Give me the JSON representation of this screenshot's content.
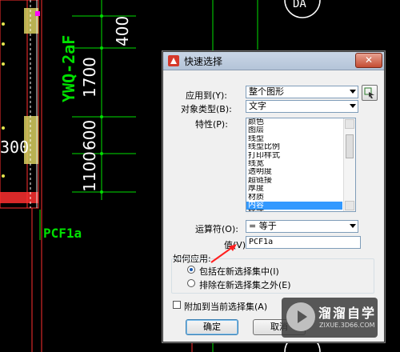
{
  "drawing": {
    "dim_400": "400",
    "dim_1700": "1700",
    "dim_600": "600",
    "dim_1100": "1100",
    "dim_left": "300",
    "vertical_label": "YWQ-2aF",
    "door_label": "PCF1a",
    "circle_label": "DA"
  },
  "dialog": {
    "title": "快速选择",
    "close": "✕",
    "apply_to_label": "应用到(Y):",
    "apply_to_value": "整个图形",
    "object_type_label": "对象类型(B):",
    "object_type_value": "文字",
    "properties_label": "特性(P):",
    "properties": [
      "颜色",
      "图层",
      "线型",
      "线型比例",
      "打印样式",
      "线宽",
      "透明度",
      "超链接",
      "厚度",
      "材质",
      "内容",
      "样式"
    ],
    "selected_property": "内容",
    "operator_label": "运算符(O):",
    "operator_value": "= 等于",
    "value_label": "值(V):",
    "value_value": "PCF1a",
    "how_to_apply_label": "如何应用:",
    "include_option": "包括在新选择集中(I)",
    "exclude_option": "排除在新选择集之外(E)",
    "append_option": "附加到当前选择集(A)",
    "ok_button": "确定",
    "cancel_button": "取消"
  },
  "watermark": {
    "title": "溜溜自学",
    "subtitle": "ZIXUE.3D66.COM"
  },
  "colors": {
    "cad_green": "#00e000",
    "cad_yellow": "#e6e64d",
    "cad_red": "#ff3030",
    "selection_blue": "#3399ff"
  }
}
